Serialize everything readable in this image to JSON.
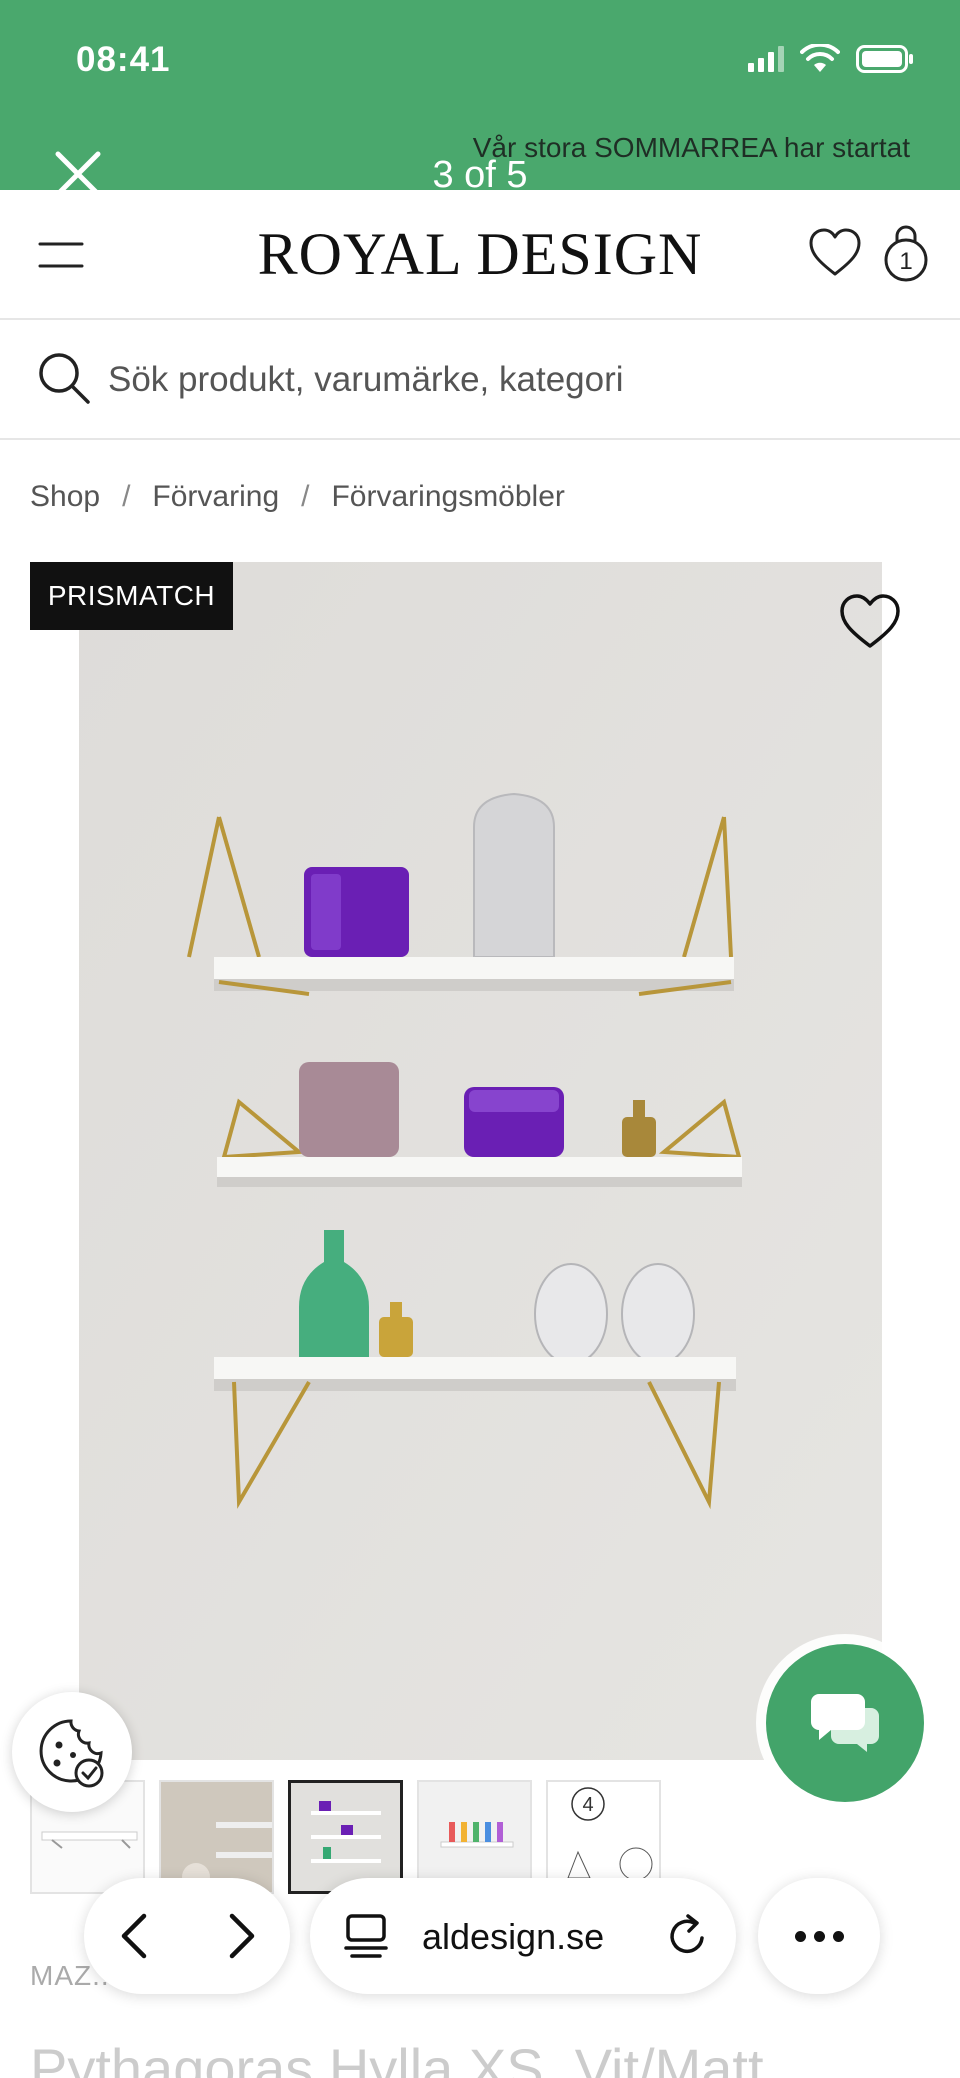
{
  "status_bar": {
    "time": "08:41"
  },
  "viewer": {
    "counter": "3 of 5",
    "banner_text": "Vår stora SOMMARREA har startat"
  },
  "header": {
    "logo": "ROYAL DESIGN",
    "cart_count": "1"
  },
  "search": {
    "placeholder": "Sök produkt, varumärke, kategori"
  },
  "breadcrumb": {
    "items": [
      "Shop",
      "Förvaring",
      "Förvaringsmöbler"
    ],
    "separator": "/"
  },
  "product": {
    "badge": "PRISMATCH",
    "brand_partial": "MAZ...",
    "title_partial": "Pythagoras Hylla XS, Vit/Matt"
  },
  "thumbnails": {
    "count": 5,
    "active_index": 2,
    "step_number": "4"
  },
  "browser": {
    "url": "royaldesign.se",
    "url_visible": "aldesign.se"
  },
  "colors": {
    "status_green": "#4aa86d",
    "chat_green": "#43a46a",
    "badge_black": "#111111",
    "photo_wall": "#e1e0dd",
    "shelf_gold": "#b8963a"
  },
  "icons": [
    "close-icon",
    "hamburger-icon",
    "heart-icon",
    "bag-icon",
    "search-icon",
    "heart-outline-icon",
    "cookie-icon",
    "chat-icon",
    "chevron-left-icon",
    "chevron-right-icon",
    "tabs-icon",
    "reload-icon",
    "more-icon"
  ]
}
